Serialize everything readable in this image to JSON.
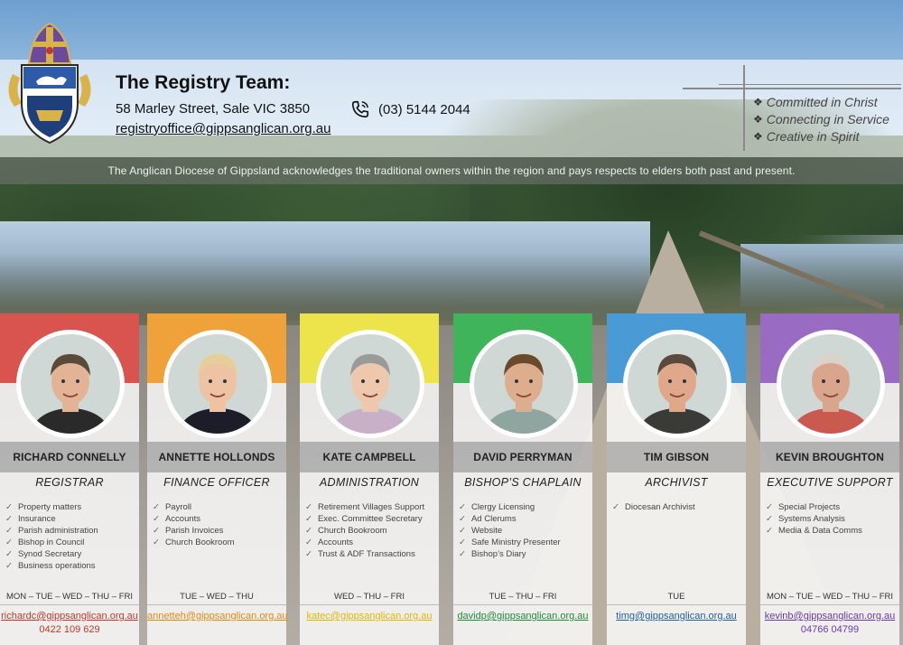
{
  "header": {
    "title": "The Registry Team:",
    "address": "58 Marley Street, Sale VIC 3850",
    "phone": "(03) 5144 2044",
    "email": "registryoffice@gippsanglican.org.au"
  },
  "mottos": [
    "Committed in Christ",
    "Connecting in Service",
    "Creative in Spirit"
  ],
  "acknowledgement": "The Anglican Diocese of Gippsland acknowledges the traditional owners within the region and pays respects to elders both past and present.",
  "colors": {
    "red": "#d9534f",
    "orange": "#f0a23a",
    "yellow": "#ede34b",
    "green": "#3fb45a",
    "blue": "#4a9ad6",
    "purple": "#9a6bc2"
  },
  "icons": {
    "phone": "phone-icon",
    "crest": "diocese-crest-icon",
    "check": "check-icon"
  },
  "team": [
    {
      "name": "RICHARD CONNELLY",
      "role": "REGISTRAR",
      "color": "#d9534f",
      "duties": [
        "Property matters",
        "Insurance",
        "Parish administration",
        "Bishop in Council",
        "Synod Secretary",
        "Business operations"
      ],
      "days": "MON – TUE – WED – THU – FRI",
      "email": "richardc@gippsanglican.org.au",
      "phone": "0422 109 629"
    },
    {
      "name": "ANNETTE HOLLONDS",
      "role": "FINANCE OFFICER",
      "color": "#f0a23a",
      "duties": [
        "Payroll",
        "Accounts",
        "Parish Invoices",
        "Church Bookroom"
      ],
      "days": "TUE – WED – THU",
      "email": "annetteh@gippsanglican.org.au",
      "phone": ""
    },
    {
      "name": "KATE CAMPBELL",
      "role": "ADMINISTRATION",
      "color": "#ede34b",
      "duties": [
        "Retirement Villages Support",
        "Exec. Committee Secretary",
        "Church Bookroom",
        "Accounts",
        "Trust & ADF Transactions"
      ],
      "days": "WED – THU – FRI",
      "email": "katec@gippsanglican.org.au",
      "phone": ""
    },
    {
      "name": "DAVID PERRYMAN",
      "role": "BISHOP’S CHAPLAIN",
      "color": "#3fb45a",
      "duties": [
        "Clergy Licensing",
        "Ad Clerums",
        "Website",
        "Safe Ministry Presenter",
        "Bishop’s Diary"
      ],
      "days": "TUE – THU – FRI",
      "email": "davidp@gippsanglican.org.au",
      "phone": ""
    },
    {
      "name": "TIM GIBSON",
      "role": "ARCHIVIST",
      "color": "#4a9ad6",
      "duties": [
        "Diocesan Archivist"
      ],
      "days": "TUE",
      "email": "timg@gippsanglican.org.au",
      "phone": ""
    },
    {
      "name": "KEVIN BROUGHTON",
      "role": "EXECUTIVE SUPPORT",
      "color": "#9a6bc2",
      "duties": [
        "Special Projects",
        "Systems Analysis",
        "Media & Data Comms"
      ],
      "days": "MON – TUE – WED – THU – FRI",
      "email": "kevinb@gippsanglican.org.au",
      "phone": "04766 04799"
    }
  ]
}
